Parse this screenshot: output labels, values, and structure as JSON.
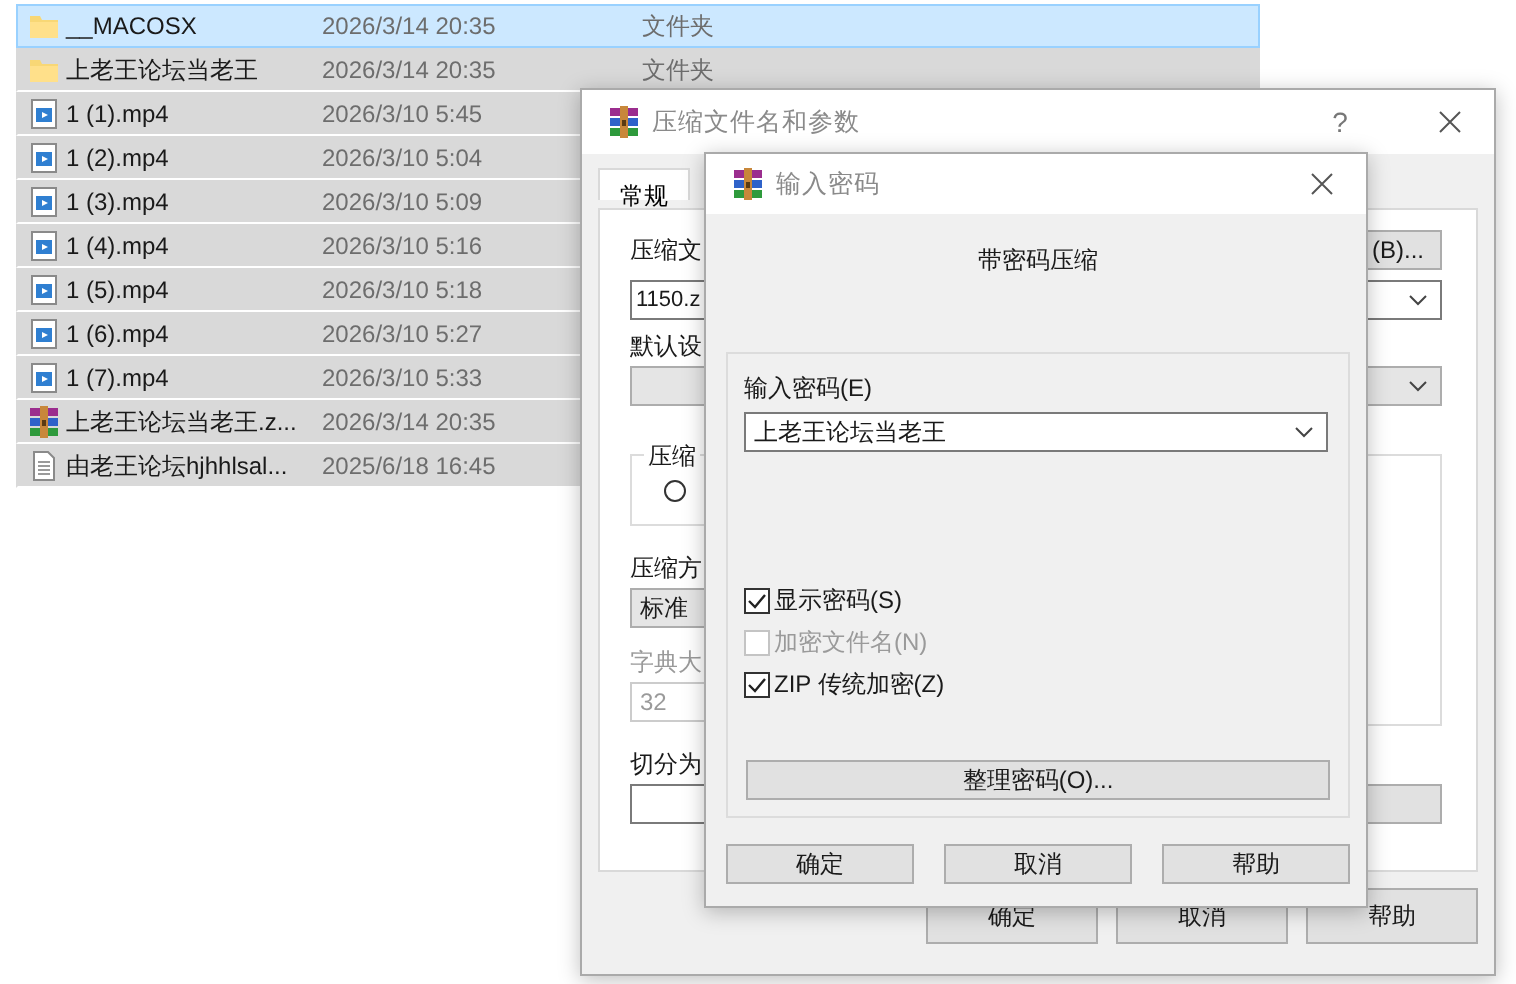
{
  "file_list": {
    "rows": [
      {
        "kind": "folder",
        "name": "__MACOSX",
        "date": "2026/3/14 20:35",
        "type": "文件夹",
        "selected": true,
        "focused": true
      },
      {
        "kind": "folder",
        "name": "上老王论坛当老王",
        "date": "2026/3/14 20:35",
        "type": "文件夹",
        "selected": true,
        "focused": false
      },
      {
        "kind": "video",
        "name": "1 (1).mp4",
        "date": "2026/3/10 5:45",
        "selected": true,
        "focused": false
      },
      {
        "kind": "video",
        "name": "1 (2).mp4",
        "date": "2026/3/10 5:04",
        "selected": true,
        "focused": false
      },
      {
        "kind": "video",
        "name": "1 (3).mp4",
        "date": "2026/3/10 5:09",
        "selected": true,
        "focused": false
      },
      {
        "kind": "video",
        "name": "1 (4).mp4",
        "date": "2026/3/10 5:16",
        "selected": true,
        "focused": false
      },
      {
        "kind": "video",
        "name": "1 (5).mp4",
        "date": "2026/3/10 5:18",
        "selected": true,
        "focused": false
      },
      {
        "kind": "video",
        "name": "1 (6).mp4",
        "date": "2026/3/10 5:27",
        "selected": true,
        "focused": false
      },
      {
        "kind": "video",
        "name": "1 (7).mp4",
        "date": "2026/3/10 5:33",
        "selected": true,
        "focused": false
      },
      {
        "kind": "archive",
        "name": "上老王论坛当老王.z...",
        "date": "2026/3/14 20:35",
        "selected": true,
        "focused": false
      },
      {
        "kind": "text",
        "name": "由老王论坛hjhhlsal...",
        "date": "2025/6/18 16:45",
        "selected": true,
        "focused": false
      }
    ]
  },
  "archive_dialog": {
    "title": "压缩文件名和参数",
    "help_button": "?",
    "tabs": [
      {
        "label": "常规",
        "selected": true
      }
    ],
    "archive_name_label": "压缩文",
    "browse_button": "(B)...",
    "archive_name": "1150.z",
    "profile_label": "默认设",
    "format_group": {
      "legend": "压缩",
      "radio_selected": false
    },
    "method_label": "压缩方",
    "method": "标准",
    "dictionary_label": "字典大",
    "dictionary": "32",
    "dictionary_disabled": true,
    "split_label": "切分为",
    "buttons": [
      "确定",
      "取消",
      "帮助"
    ]
  },
  "password_dialog": {
    "title": "输入密码",
    "heading": "带密码压缩",
    "password_label": "输入密码(E)",
    "password": "上老王论坛当老王",
    "options": [
      {
        "label": "显示密码(S)",
        "checked": true,
        "disabled": false
      },
      {
        "label": "加密文件名(N)",
        "checked": false,
        "disabled": true
      },
      {
        "label": "ZIP 传统加密(Z)",
        "checked": true,
        "disabled": false
      }
    ],
    "manage_button": "整理密码(O)...",
    "buttons": [
      "确定",
      "取消",
      "帮助"
    ]
  }
}
